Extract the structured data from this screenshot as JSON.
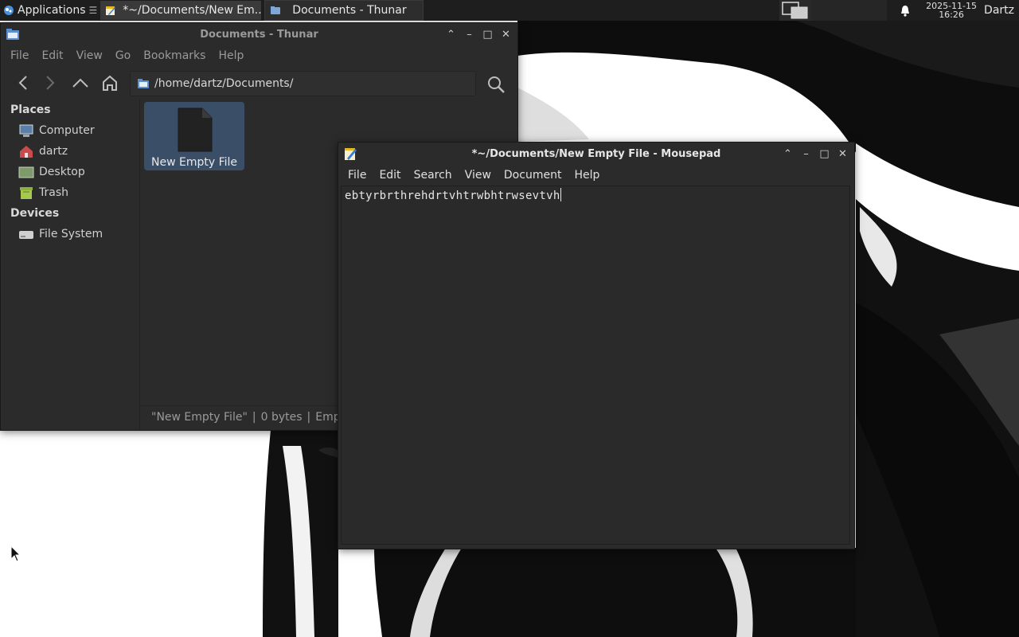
{
  "panel": {
    "applications_label": "Applications",
    "tasks": [
      {
        "label": "*~/Documents/New Em...",
        "icon": "mousepad-icon"
      },
      {
        "label": "Documents - Thunar",
        "icon": "folder-icon"
      }
    ],
    "clock_date": "2025-11-15",
    "clock_time": "16:26",
    "user": "Dartz"
  },
  "thunar": {
    "title": "Documents - Thunar",
    "menu": [
      "File",
      "Edit",
      "View",
      "Go",
      "Bookmarks",
      "Help"
    ],
    "path": "/home/dartz/Documents/",
    "sidebar": {
      "places_header": "Places",
      "places": [
        {
          "label": "Computer",
          "icon": "computer-icon"
        },
        {
          "label": "dartz",
          "icon": "home-icon"
        },
        {
          "label": "Desktop",
          "icon": "desktop-icon"
        },
        {
          "label": "Trash",
          "icon": "trash-icon"
        }
      ],
      "devices_header": "Devices",
      "devices": [
        {
          "label": "File System",
          "icon": "drive-icon"
        }
      ]
    },
    "files": [
      {
        "name": "New Empty File",
        "selected": true,
        "icon": "empty-file-icon"
      }
    ],
    "status": {
      "name": "\"New Empty File\"",
      "sep": "|",
      "size": "0 bytes",
      "type": "Empt"
    }
  },
  "mousepad": {
    "title": "*~/Documents/New Empty File - Mousepad",
    "menu": [
      "File",
      "Edit",
      "Search",
      "View",
      "Document",
      "Help"
    ],
    "content": "ebtyrbrthrehdrtvhtrwbhtrwsevtvh"
  },
  "colors": {
    "panel_bg": "#1e1e1e",
    "window_bg": "#2b2b2b",
    "selection": "#3a4f67",
    "text": "#e6e6e6"
  }
}
